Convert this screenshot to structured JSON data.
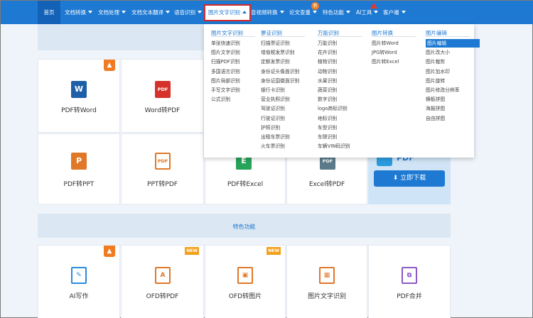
{
  "nav": {
    "home": "首页",
    "items": [
      "文档转换",
      "文档处理",
      "文档文本翻译",
      "语音识别",
      "图片文字识别",
      "音视频转换",
      "论文查重",
      "特色功能",
      "AI工具",
      "客户端"
    ],
    "badge_new": "新"
  },
  "dropdown": {
    "columns": [
      {
        "title": "图片文字识别",
        "items": [
          "单张快速识别",
          "图片文字识别",
          "扫描PDF识别",
          "多国语言识别",
          "图片局部识别",
          "手写文字识别",
          "公式识别"
        ]
      },
      {
        "title": "票证识别",
        "items": [
          "扫描票证识别",
          "增值税发票识别",
          "定额发票识别",
          "身份证头像面识别",
          "身份证国徽面识别",
          "银行卡识别",
          "营业执照识别",
          "驾驶证识别",
          "行驶证识别",
          "护照识别",
          "出租车票识别",
          "火车票识别"
        ]
      },
      {
        "title": "万能识别",
        "items": [
          "万能识别",
          "花卉识别",
          "植物识别",
          "动物识别",
          "水果识别",
          "蔬菜识别",
          "数字识别",
          "logo商标识别",
          "地标识别",
          "车型识别",
          "车牌识别",
          "车辆VIN码识别"
        ]
      },
      {
        "title": "图片转换",
        "items": [
          "图片转Word",
          "JPG转Word",
          "图片转Excel"
        ]
      },
      {
        "title": "图片编辑",
        "items": [
          "图片编辑",
          "图片改大小",
          "图片裁剪",
          "图片加水印",
          "图片旋转",
          "图片修改分辨率",
          "横板拼图",
          "海报拼图",
          "自由拼图"
        ]
      }
    ]
  },
  "cards_row1": [
    {
      "label": "PDF转Word",
      "icon": "W",
      "color": "#1e5fa8"
    },
    {
      "label": "Word转PDF",
      "icon": "PDF",
      "color": "#d4322a"
    }
  ],
  "cards_row2": [
    {
      "label": "PDF转PPT",
      "icon": "P",
      "color": "#e07828"
    },
    {
      "label": "PPT转PDF",
      "icon": "PDF",
      "color": "#e07828"
    },
    {
      "label": "PDF转Excel",
      "icon": "E",
      "color": "#27a35a"
    },
    {
      "label": "Excel转PDF",
      "icon": "PDF",
      "color": "#5b7b8a"
    }
  ],
  "download": {
    "button": "立即下载"
  },
  "featured": {
    "title": "特色功能",
    "badge_new": "NEW",
    "cards": [
      {
        "label": "AI写作",
        "color": "#2b8ae0"
      },
      {
        "label": "OFD转PDF",
        "color": "#e07828"
      },
      {
        "label": "OFD转图片",
        "color": "#e07828"
      },
      {
        "label": "图片文字识别",
        "color": "#e07828"
      },
      {
        "label": "PDF合并",
        "color": "#8a5bc4"
      }
    ]
  }
}
